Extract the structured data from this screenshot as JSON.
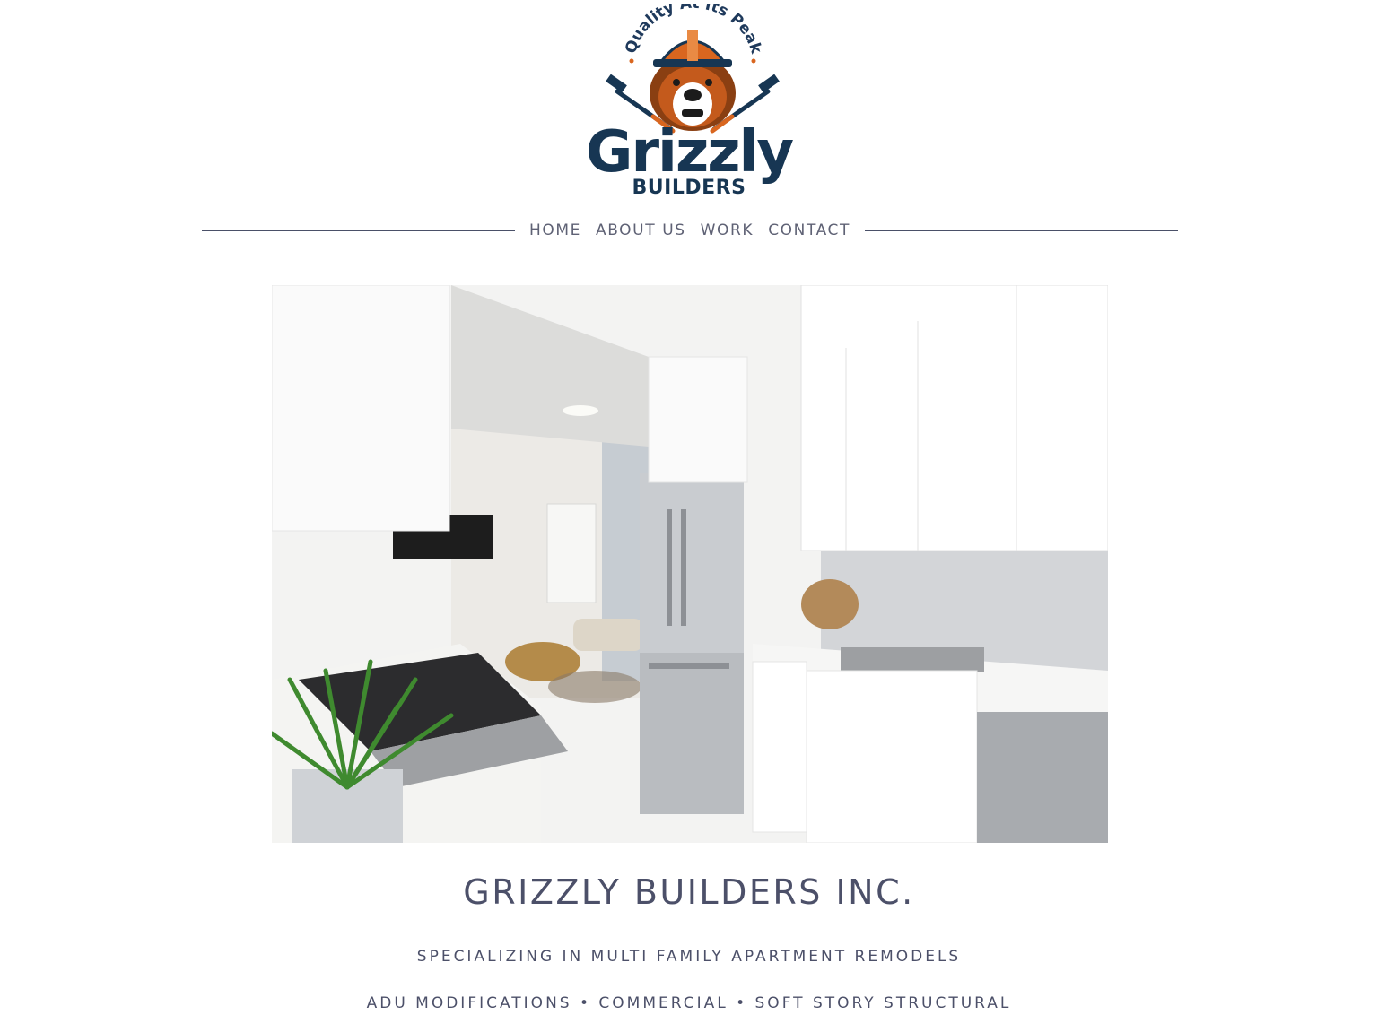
{
  "logo": {
    "tagline": "Quality At Its Peak",
    "wordmark": "Grizzly",
    "submark": "BUILDERS",
    "colors": {
      "navy": "#173653",
      "orange": "#d9661f",
      "brown": "#8a3f12"
    }
  },
  "nav": {
    "items": [
      {
        "label": "HOME"
      },
      {
        "label": "ABOUT US"
      },
      {
        "label": "WORK"
      },
      {
        "label": "CONTACT"
      }
    ]
  },
  "hero": {
    "image_alt": "Kitchen photo"
  },
  "content": {
    "title": "GRIZZLY BUILDERS INC.",
    "subtitle": "SPECIALIZING IN MULTI FAMILY APARTMENT REMODELS",
    "services": "ADU MODIFICATIONS • COMMERCIAL • SOFT STORY STRUCTURAL"
  }
}
